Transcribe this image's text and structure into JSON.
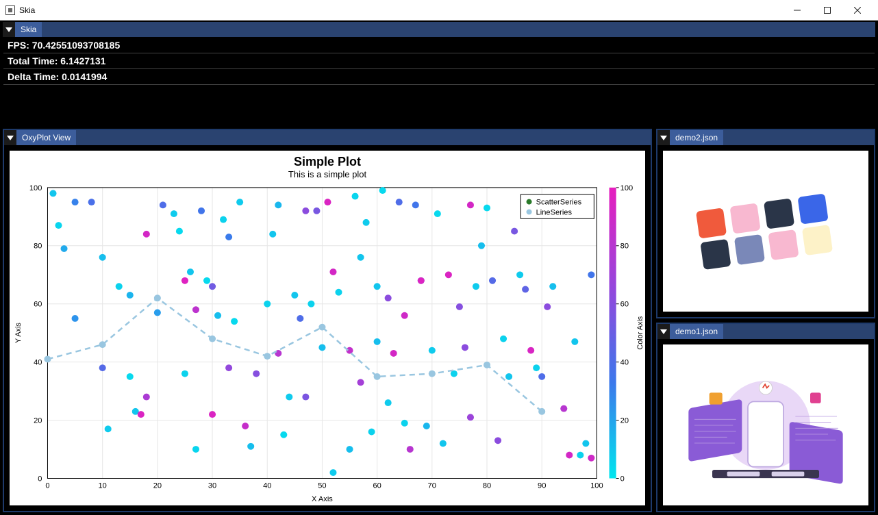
{
  "window": {
    "title": "Skia"
  },
  "top_tab": "Skia",
  "stats": {
    "fps_label": "FPS: 70.42551093708185",
    "total_label": "Total Time: 6.1427131",
    "delta_label": "Delta Time: 0.0141994"
  },
  "plot_panel": {
    "tab": "OxyPlot View"
  },
  "right_panels": {
    "demo2_tab": "demo2.json",
    "demo1_tab": "demo1.json"
  },
  "chart_data": {
    "type": "scatter",
    "title": "Simple Plot",
    "subtitle": "This is a simple plot",
    "xlabel": "X Axis",
    "ylabel": "Y Axis",
    "color_axis_label": "Color Axis",
    "xlim": [
      0,
      100
    ],
    "ylim": [
      0,
      100
    ],
    "color_lim": [
      0,
      100
    ],
    "xticks": [
      0,
      10,
      20,
      30,
      40,
      50,
      60,
      70,
      80,
      90,
      100
    ],
    "yticks": [
      0,
      20,
      40,
      60,
      80,
      100
    ],
    "color_ticks": [
      0,
      20,
      40,
      60,
      80,
      100
    ],
    "legend": [
      "ScatterSeries",
      "LineSeries"
    ],
    "line_series": {
      "x": [
        0,
        10,
        20,
        30,
        40,
        50,
        60,
        70,
        80,
        90
      ],
      "y": [
        41,
        46,
        62,
        48,
        42,
        52,
        35,
        36,
        39,
        23
      ]
    },
    "scatter_series": [
      {
        "x": 2,
        "y": 87,
        "c": 5
      },
      {
        "x": 1,
        "y": 98,
        "c": 10
      },
      {
        "x": 3,
        "y": 79,
        "c": 18
      },
      {
        "x": 5,
        "y": 55,
        "c": 25
      },
      {
        "x": 5,
        "y": 95,
        "c": 30
      },
      {
        "x": 8,
        "y": 95,
        "c": 38
      },
      {
        "x": 10,
        "y": 76,
        "c": 12
      },
      {
        "x": 10,
        "y": 38,
        "c": 42
      },
      {
        "x": 11,
        "y": 17,
        "c": 8
      },
      {
        "x": 13,
        "y": 66,
        "c": 6
      },
      {
        "x": 15,
        "y": 35,
        "c": 4
      },
      {
        "x": 15,
        "y": 63,
        "c": 15
      },
      {
        "x": 16,
        "y": 23,
        "c": 10
      },
      {
        "x": 17,
        "y": 22,
        "c": 95
      },
      {
        "x": 18,
        "y": 84,
        "c": 92
      },
      {
        "x": 18,
        "y": 28,
        "c": 75
      },
      {
        "x": 20,
        "y": 57,
        "c": 22
      },
      {
        "x": 21,
        "y": 94,
        "c": 40
      },
      {
        "x": 23,
        "y": 91,
        "c": 8
      },
      {
        "x": 24,
        "y": 85,
        "c": 4
      },
      {
        "x": 25,
        "y": 36,
        "c": 6
      },
      {
        "x": 25,
        "y": 68,
        "c": 97
      },
      {
        "x": 26,
        "y": 71,
        "c": 10
      },
      {
        "x": 27,
        "y": 58,
        "c": 82
      },
      {
        "x": 27,
        "y": 10,
        "c": 5
      },
      {
        "x": 28,
        "y": 92,
        "c": 35
      },
      {
        "x": 29,
        "y": 68,
        "c": 4
      },
      {
        "x": 30,
        "y": 66,
        "c": 52
      },
      {
        "x": 30,
        "y": 22,
        "c": 95
      },
      {
        "x": 31,
        "y": 56,
        "c": 12
      },
      {
        "x": 32,
        "y": 89,
        "c": 6
      },
      {
        "x": 33,
        "y": 38,
        "c": 65
      },
      {
        "x": 33,
        "y": 83,
        "c": 32
      },
      {
        "x": 34,
        "y": 54,
        "c": 4
      },
      {
        "x": 35,
        "y": 95,
        "c": 8
      },
      {
        "x": 36,
        "y": 18,
        "c": 86
      },
      {
        "x": 37,
        "y": 11,
        "c": 12
      },
      {
        "x": 38,
        "y": 36,
        "c": 60
      },
      {
        "x": 40,
        "y": 60,
        "c": 6
      },
      {
        "x": 41,
        "y": 84,
        "c": 10
      },
      {
        "x": 42,
        "y": 94,
        "c": 14
      },
      {
        "x": 42,
        "y": 43,
        "c": 80
      },
      {
        "x": 43,
        "y": 15,
        "c": 4
      },
      {
        "x": 44,
        "y": 28,
        "c": 8
      },
      {
        "x": 45,
        "y": 63,
        "c": 10
      },
      {
        "x": 46,
        "y": 55,
        "c": 40
      },
      {
        "x": 47,
        "y": 92,
        "c": 62
      },
      {
        "x": 47,
        "y": 28,
        "c": 56
      },
      {
        "x": 48,
        "y": 60,
        "c": 6
      },
      {
        "x": 49,
        "y": 92,
        "c": 55
      },
      {
        "x": 50,
        "y": 45,
        "c": 12
      },
      {
        "x": 51,
        "y": 95,
        "c": 95
      },
      {
        "x": 52,
        "y": 71,
        "c": 92
      },
      {
        "x": 52,
        "y": 2,
        "c": 8
      },
      {
        "x": 53,
        "y": 64,
        "c": 6
      },
      {
        "x": 55,
        "y": 44,
        "c": 85
      },
      {
        "x": 55,
        "y": 10,
        "c": 12
      },
      {
        "x": 56,
        "y": 97,
        "c": 5
      },
      {
        "x": 57,
        "y": 76,
        "c": 10
      },
      {
        "x": 57,
        "y": 33,
        "c": 72
      },
      {
        "x": 58,
        "y": 88,
        "c": 8
      },
      {
        "x": 59,
        "y": 16,
        "c": 6
      },
      {
        "x": 60,
        "y": 66,
        "c": 10
      },
      {
        "x": 60,
        "y": 47,
        "c": 12
      },
      {
        "x": 61,
        "y": 99,
        "c": 4
      },
      {
        "x": 62,
        "y": 62,
        "c": 62
      },
      {
        "x": 62,
        "y": 26,
        "c": 8
      },
      {
        "x": 63,
        "y": 43,
        "c": 92
      },
      {
        "x": 64,
        "y": 95,
        "c": 40
      },
      {
        "x": 65,
        "y": 56,
        "c": 90
      },
      {
        "x": 65,
        "y": 19,
        "c": 6
      },
      {
        "x": 66,
        "y": 10,
        "c": 80
      },
      {
        "x": 67,
        "y": 94,
        "c": 35
      },
      {
        "x": 68,
        "y": 68,
        "c": 10
      },
      {
        "x": 68,
        "y": 68,
        "c": 96
      },
      {
        "x": 69,
        "y": 18,
        "c": 14
      },
      {
        "x": 70,
        "y": 44,
        "c": 8
      },
      {
        "x": 71,
        "y": 91,
        "c": 4
      },
      {
        "x": 72,
        "y": 12,
        "c": 10
      },
      {
        "x": 73,
        "y": 70,
        "c": 95
      },
      {
        "x": 74,
        "y": 36,
        "c": 6
      },
      {
        "x": 75,
        "y": 59,
        "c": 60
      },
      {
        "x": 76,
        "y": 45,
        "c": 62
      },
      {
        "x": 77,
        "y": 94,
        "c": 92
      },
      {
        "x": 77,
        "y": 21,
        "c": 68
      },
      {
        "x": 78,
        "y": 66,
        "c": 8
      },
      {
        "x": 79,
        "y": 80,
        "c": 12
      },
      {
        "x": 80,
        "y": 93,
        "c": 4
      },
      {
        "x": 81,
        "y": 68,
        "c": 42
      },
      {
        "x": 82,
        "y": 13,
        "c": 62
      },
      {
        "x": 83,
        "y": 48,
        "c": 6
      },
      {
        "x": 84,
        "y": 35,
        "c": 10
      },
      {
        "x": 85,
        "y": 85,
        "c": 55
      },
      {
        "x": 86,
        "y": 70,
        "c": 8
      },
      {
        "x": 87,
        "y": 65,
        "c": 46
      },
      {
        "x": 88,
        "y": 44,
        "c": 94
      },
      {
        "x": 89,
        "y": 38,
        "c": 6
      },
      {
        "x": 90,
        "y": 35,
        "c": 40
      },
      {
        "x": 91,
        "y": 59,
        "c": 62
      },
      {
        "x": 92,
        "y": 66,
        "c": 12
      },
      {
        "x": 94,
        "y": 24,
        "c": 80
      },
      {
        "x": 95,
        "y": 8,
        "c": 92
      },
      {
        "x": 96,
        "y": 47,
        "c": 10
      },
      {
        "x": 97,
        "y": 8,
        "c": 6
      },
      {
        "x": 98,
        "y": 12,
        "c": 10
      },
      {
        "x": 99,
        "y": 7,
        "c": 90
      },
      {
        "x": 99,
        "y": 70,
        "c": 35
      }
    ]
  },
  "demo2_colors": [
    "#f05a3c",
    "#f8b8d0",
    "#2a3548",
    "#3a66e8",
    "#2a3548",
    "#7a88b8",
    "#f8b8d0",
    "#fdf2c8"
  ]
}
